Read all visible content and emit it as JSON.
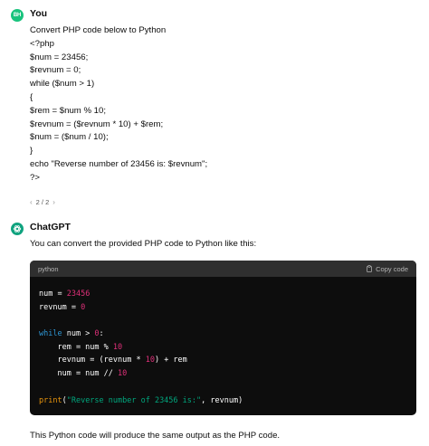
{
  "user_message": {
    "author": "You",
    "avatar_initials": "BH",
    "lines": [
      "Convert PHP code below to Python",
      "<?php",
      "$num = 23456;",
      "$revnum = 0;",
      "while ($num > 1)",
      "{",
      "$rem = $num % 10;",
      "$revnum = ($revnum * 10) + $rem;",
      "$num = ($num / 10);",
      "}",
      "echo \"Reverse number of 23456 is: $revnum\";",
      "?>"
    ]
  },
  "pager": {
    "prev_icon": "chevron-left-icon",
    "label": "2 / 2",
    "next_icon": "chevron-right-icon"
  },
  "assistant_message": {
    "author": "ChatGPT",
    "intro": "You can convert the provided PHP code to Python like this:",
    "outro": "This Python code will produce the same output as the PHP code.",
    "code": {
      "language": "python",
      "copy_label": "Copy code",
      "copy_icon": "clipboard-icon",
      "tokens": {
        "l1_var": "num",
        "l1_op": " = ",
        "l1_num": "23456",
        "l2_var": "revnum",
        "l2_op": " = ",
        "l2_num": "0",
        "l4_kw": "while",
        "l4_rest": " num > ",
        "l4_num": "0",
        "l4_colon": ":",
        "l5_a": "    rem = num % ",
        "l5_num": "10",
        "l6_a": "    revnum = (revnum * ",
        "l6_num": "10",
        "l6_b": ") + rem",
        "l7_a": "    num = num // ",
        "l7_num": "10",
        "l9_fn": "print",
        "l9_open": "(",
        "l9_str": "\"Reverse number of 23456 is:\"",
        "l9_rest": ", revnum)"
      }
    }
  },
  "colors": {
    "code_bg": "#0d0d0d",
    "code_header_bg": "#2f2f2f",
    "keyword": "#2e95d3",
    "number": "#df3079",
    "string": "#00a67d",
    "builtin": "#e9950c",
    "user_avatar": "#19c37d",
    "gpt_avatar": "#10a37f"
  }
}
